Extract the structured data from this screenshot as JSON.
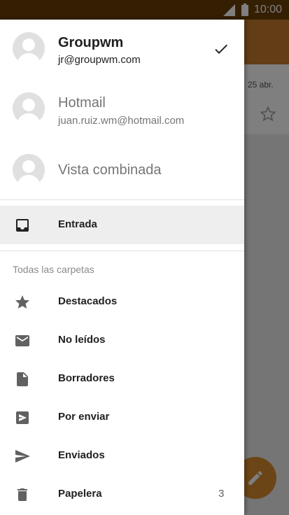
{
  "status_bar": {
    "time": "10:00"
  },
  "background": {
    "date": "25 abr."
  },
  "accounts": [
    {
      "name": "Groupwm",
      "email": "jr@groupwm.com",
      "selected": true
    },
    {
      "name": "Hotmail",
      "email": "juan.ruiz.wm@hotmail.com",
      "selected": false
    },
    {
      "name": "Vista combinada"
    }
  ],
  "inbox": {
    "label": "Entrada",
    "icon": "inbox-icon"
  },
  "folders_section": {
    "label": "Todas las carpetas"
  },
  "folders": [
    {
      "label": "Destacados",
      "icon": "star-icon"
    },
    {
      "label": "No leídos",
      "icon": "mail-icon"
    },
    {
      "label": "Borradores",
      "icon": "draft-icon"
    },
    {
      "label": "Por enviar",
      "icon": "outbox-icon"
    },
    {
      "label": "Enviados",
      "icon": "send-icon"
    },
    {
      "label": "Papelera",
      "icon": "trash-icon",
      "count": "3"
    }
  ],
  "colors": {
    "status_bar": "#6b3f07",
    "toolbar": "#c47a2a",
    "fab": "#d98a2c"
  }
}
